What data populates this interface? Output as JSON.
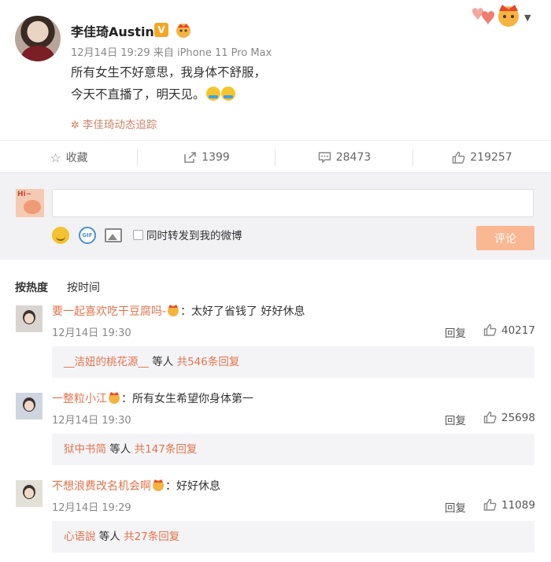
{
  "post": {
    "author": "李佳琦Austin",
    "verified_badge": "V",
    "time": "12月14日 19:29",
    "source_prefix": "来自",
    "source": "iPhone 11 Pro Max",
    "line1": "所有女生不好意思，我身体不舒服，",
    "line2": "今天不直播了，明天见。",
    "topic": "李佳琦动态追踪",
    "topic_icon": "fan-sparkle-icon",
    "more_icon": "chevron-down-icon"
  },
  "actions": {
    "favorite_label": "收藏",
    "repost_count": "1399",
    "comment_count": "28473",
    "like_count": "219257"
  },
  "composer": {
    "input_value": "",
    "sync_label": "同时转发到我的微博",
    "submit_label": "评论",
    "accent": "#f9b792"
  },
  "sort": {
    "hot": "按热度",
    "time": "按时间"
  },
  "comments": [
    {
      "name": "要一起喜欢吃干豆腐吗-",
      "text": "：太好了省钱了 好好休息",
      "time": "12月14日 19:30",
      "reply": "回复",
      "likes": "40217",
      "sub_name": "__洁妞的桃花源__",
      "sub_mid": " 等人 ",
      "sub_count": "共546条回复"
    },
    {
      "name": "一整粒小江",
      "text": "：所有女生希望你身体第一",
      "time": "12月14日 19:30",
      "reply": "回复",
      "likes": "25698",
      "sub_name": "狱中书简",
      "sub_mid": " 等人 ",
      "sub_count": "共147条回复"
    },
    {
      "name": "不想浪费改名机会啊",
      "text": "：好好休息",
      "time": "12月14日 19:29",
      "reply": "回复",
      "likes": "11089",
      "sub_name": "心语說",
      "sub_mid": " 等人 ",
      "sub_count": "共27条回复"
    }
  ],
  "colors": {
    "link": "#e2734c",
    "muted": "#888888",
    "panel": "#f2f2f5"
  }
}
